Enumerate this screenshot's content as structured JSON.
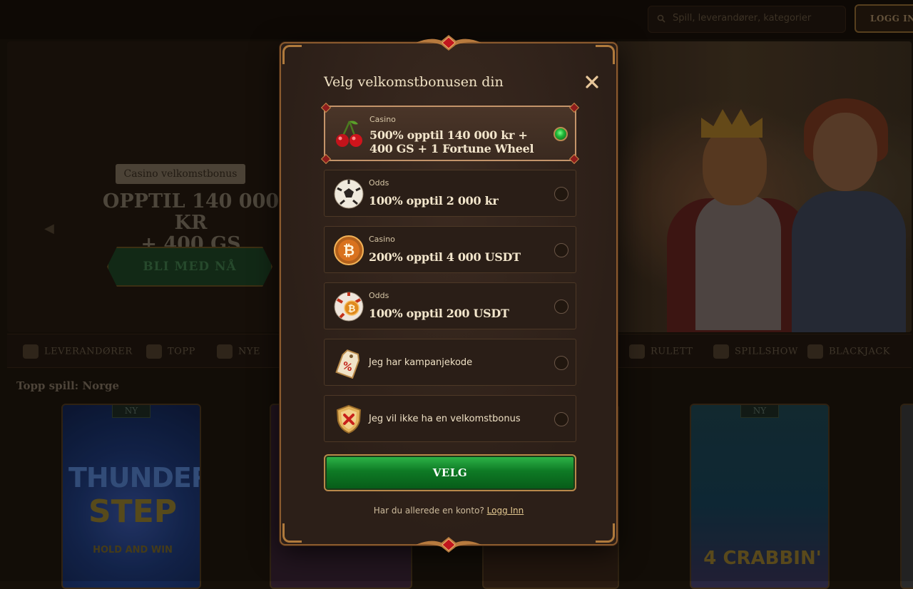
{
  "header": {
    "search_placeholder": "Spill, leverandører, kategorier",
    "login_label": "LOGG INN"
  },
  "hero": {
    "badge": "Casino velkomstbonus",
    "title_line1": "OPPTIL 140 000 KR",
    "title_line2": "+ 400 GS",
    "cta_label": "BLI MED NÅ"
  },
  "categories": [
    {
      "label": "LEVERANDØRER",
      "icon": "providers-icon"
    },
    {
      "label": "TOPP",
      "icon": "crown-icon"
    },
    {
      "label": "NYE",
      "icon": "lightning-icon"
    },
    {
      "label": "RULETT",
      "icon": "roulette-icon"
    },
    {
      "label": "SPILLSHOW",
      "icon": "microphone-icon"
    },
    {
      "label": "BLACKJACK",
      "icon": "cards-icon"
    }
  ],
  "games_section": {
    "title": "Topp spill: Norge",
    "new_badge": "NY",
    "cards": [
      {
        "title_line1": "THUNDER",
        "title_line2": "STEP",
        "subtitle": "HOLD AND WIN",
        "badge": "NY"
      },
      {
        "title_line1": "",
        "badge": ""
      },
      {
        "title_line1": "",
        "badge": ""
      },
      {
        "title_line1": "4 CRABBIN'",
        "badge": "NY"
      }
    ]
  },
  "modal": {
    "title": "Velg velkomstbonusen din",
    "options": [
      {
        "category": "Casino",
        "text": "500% opptil 140 000 kr + 400 GS + 1 Fortune Wheel",
        "icon": "cherries-icon",
        "selected": true
      },
      {
        "category": "Odds",
        "text": "100% opptil 2 000 kr",
        "icon": "soccer-ball-icon",
        "selected": false
      },
      {
        "category": "Casino",
        "text": "200% opptil 4 000 USDT",
        "icon": "bitcoin-coin-icon",
        "selected": false
      },
      {
        "category": "Odds",
        "text": "100% opptil 200 USDT",
        "icon": "bitcoin-soccer-ball-icon",
        "selected": false
      },
      {
        "category": "",
        "text": "Jeg har kampanjekode",
        "icon": "promo-tag-icon",
        "selected": false
      },
      {
        "category": "",
        "text": "Jeg vil ikke ha en velkomstbonus",
        "icon": "shield-x-icon",
        "selected": false
      }
    ],
    "submit_label": "VELG",
    "footer_text": "Har du allerede en konto?",
    "footer_link": "Logg Inn"
  },
  "colors": {
    "accent_gold": "#c4946a",
    "button_green": "#0e7a25",
    "modal_bg": "#2e2019"
  }
}
